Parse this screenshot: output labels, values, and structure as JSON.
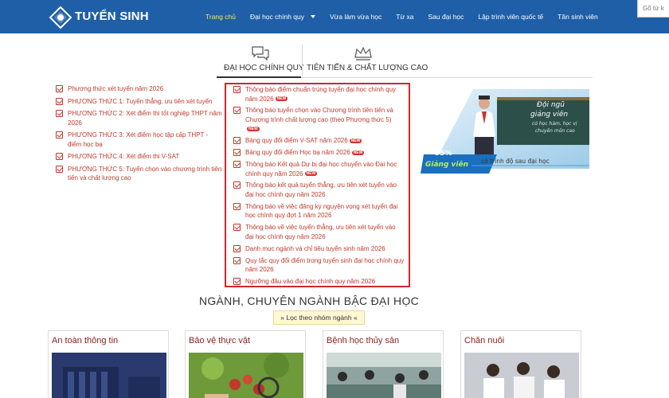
{
  "header": {
    "brand": "TUYỂN SINH",
    "nav": [
      {
        "label": "Trang chủ",
        "active": true
      },
      {
        "label": "Đại học chính quy",
        "dropdown": true
      },
      {
        "label": "Vừa làm vừa học"
      },
      {
        "label": "Từ xa"
      },
      {
        "label": "Sau đại học"
      },
      {
        "label": "Lập trình viên quốc tế"
      },
      {
        "label": "Tân sinh viên"
      }
    ],
    "search_text": "Gõ từ k",
    "colors": {
      "bar": "#1f5fa8",
      "active": "#ffe066"
    }
  },
  "tabs": [
    {
      "label": "ĐẠI HỌC CHÍNH QUY",
      "icon": "chat-bubbles-icon",
      "active": true
    },
    {
      "label": "TIÊN TIẾN & CHẤT LƯỢNG CAO",
      "icon": "crown-icon"
    }
  ],
  "left_list": [
    "Phương thức xét tuyển năm 2026",
    "PHƯƠNG THỨC 1: Tuyển thẳng, ưu tiên xét tuyển",
    "PHƯƠNG THỨC 2: Xét điểm thi tốt nghiệp THPT năm 2026",
    "PHƯƠNG THỨC 3: Xét điểm học tập cấp THPT - điểm học bạ",
    "PHƯƠNG THỨC 4: Xét điểm thi V-SAT",
    "PHƯƠNG THỨC 5: Tuyển chọn vào chương trình tiên tiến và chất lượng cao"
  ],
  "center_list": [
    {
      "text": "Thông báo điểm chuẩn trúng tuyển đại học chính quy năm 2026",
      "new": true
    },
    {
      "text": "Thông báo tuyển chọn vào Chương trình tiên tiến và Chương trình chất lượng cao (theo Phương thức 5)",
      "new": true
    },
    {
      "text": "Bảng quy đổi điểm V-SAT năm 2026",
      "new": true
    },
    {
      "text": "Bảng quy đổi điểm Học bạ năm 2026",
      "new": true
    },
    {
      "text": "Thông báo Kết quả Dự bị đại học chuyển vào Đại học chính quy năm 2026",
      "new": true
    },
    {
      "text": "Thông báo kết quả tuyển thẳng, ưu tiên xét tuyển vào đại học chính quy năm 2026",
      "new": false
    },
    {
      "text": "Thông báo về việc đăng ký nguyện vọng xét tuyển đại học chính quy đợt 1 năm 2026",
      "new": false
    },
    {
      "text": "Thông báo về việc tuyển thẳng, ưu tiên xét tuyển vào đại học chính quy năm 2026",
      "new": false
    },
    {
      "text": "Danh mục ngành và chỉ tiêu tuyển sinh năm 2026",
      "new": false
    },
    {
      "text": "Quy tắc quy đổi điểm trong tuyển sinh đại học chính quy năm 2026",
      "new": false
    },
    {
      "text": "Ngưỡng đầu vào đại học chính quy năm 2026",
      "new": false
    }
  ],
  "new_badge": "NEW",
  "banner": {
    "heading_lines": [
      "Đội ngũ",
      "giảng viên"
    ],
    "sub_lines": [
      "có học hàm, học vị",
      "chuyên môn cao"
    ],
    "percent": "95%",
    "percent_label": "Giảng viên",
    "caption": "có trình độ sau đại học"
  },
  "section": {
    "title": "NGÀNH, CHUYÊN NGÀNH BẬC ĐẠI HỌC",
    "filter": "» Lọc theo nhóm ngành «"
  },
  "cards": [
    {
      "title": "An toàn thông tin"
    },
    {
      "title": "Bảo vệ thực vật"
    },
    {
      "title": "Bệnh học thủy sản"
    },
    {
      "title": "Chăn nuôi"
    }
  ]
}
